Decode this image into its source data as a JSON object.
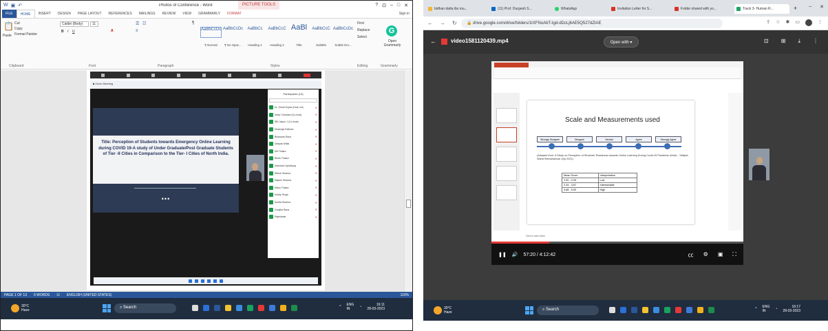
{
  "word": {
    "doc_title": "Photos of Conference - Word",
    "picture_tools": "PICTURE TOOLS",
    "win_controls": [
      "?",
      "⊡",
      "–",
      "□",
      "✕"
    ],
    "tabs": [
      "FILE",
      "HOME",
      "INSERT",
      "DESIGN",
      "PAGE LAYOUT",
      "REFERENCES",
      "MAILINGS",
      "REVIEW",
      "VIEW",
      "GRAMMARLY",
      "FORMAT"
    ],
    "sign_in": "Sign in",
    "clipboard": {
      "cut": "Cut",
      "copy": "Copy",
      "paste": "Paste",
      "format_painter": "Format Painter",
      "label": "Clipboard"
    },
    "font": {
      "name": "Calibri (Body)",
      "size": "11",
      "label": "Font"
    },
    "paragraph_label": "Paragraph",
    "styles": [
      {
        "preview": "AaBbCcDc",
        "name": "¶ Normal"
      },
      {
        "preview": "AaBbCcDc",
        "name": "¶ No Spac..."
      },
      {
        "preview": "AaBbCc",
        "name": "Heading 1"
      },
      {
        "preview": "AaBbCcC",
        "name": "Heading 2"
      },
      {
        "preview": "AaBl",
        "name": "Title"
      },
      {
        "preview": "AaBbCcC",
        "name": "Subtitle"
      },
      {
        "preview": "AaBbCcDc",
        "name": "Subtle Em..."
      }
    ],
    "styles_label": "Styles",
    "editing": {
      "find": "Find",
      "replace": "Replace",
      "select": "Select",
      "label": "Editing"
    },
    "grammarly": {
      "logo": "G",
      "open": "Open Grammarly",
      "label": "Grammarly"
    },
    "meeting": {
      "slide_title": "Title: Perception of Students towards Emergency Online Learning during COVID 19-A study of Under Graduate/Post Graduate Students of Tier -II Cities in Comparison to the Tier- I Cities of North India.",
      "dots": "•••",
      "participants_header": "Participants (19)",
      "participants": [
        "Dr. Shruti Gupta (Host, me)",
        "Deep Chauhan (Co-host)",
        "IBS Jaipur 1 (Co-host)",
        "Dhanraja Rathore",
        "Bhawana Rana",
        "Deepak Mittal",
        "Kiti Thakur",
        "Bindu Thakur",
        "Ashutosh Upadhyay",
        "Ritesh Sharma",
        "Rajeev Sharma",
        "Manu Thakur",
        "Kuldip Singh",
        "Sunita Sharma",
        "Gunjika Rana",
        "Rajeshwar"
      ]
    },
    "status": {
      "page": "PAGE 1 OF 13",
      "words": "0 WORDS",
      "language": "ENGLISH (UNITED STATES)",
      "zoom": "110%"
    }
  },
  "taskbar_left": {
    "temp": "30°C",
    "weather": "Haze",
    "search": "Search",
    "lang": "ENG",
    "region": "IN",
    "time": "16:11",
    "date": "28-03-2023"
  },
  "chrome": {
    "tabs": [
      "bidhan datta ibs mu...",
      "(11) Prof. Durgesh S...",
      "WhatsApp",
      "Invitation Letter for S...",
      "Folder shared with yo...",
      "Track 3- Human R..."
    ],
    "url": "drive.google.com/drive/folders/1tXFNoAbT-Igd-dDcLj6AE5Q527dZIAE",
    "file_name": "video1581120439.mp4",
    "open_with": "Open with",
    "video_time": "57:20 / 4:12:42",
    "progress": 0.23,
    "slide_heading": "Scale and Measurements used",
    "scale_points": [
      "Strongly Disagree",
      "Disagree",
      "Neutral",
      "Agree",
      "Strongly Agree"
    ],
    "caption": "(Adopted from: A Study on Perception of Students' Readiness towards Online Learning During Covid-19 Pandemic Article - Taifiyah Wahid Ramananwar July 2021)",
    "table_header": [
      "Mean Score",
      "Interpretation"
    ],
    "table_rows": [
      [
        "1.00 - 2.33",
        "Low"
      ],
      [
        "2.34 - 3.67",
        "Intermediate"
      ],
      [
        "3.68 - 5.00",
        "High"
      ]
    ],
    "click_notes": "Click to add notes"
  },
  "taskbar_right": {
    "temp": "30°C",
    "weather": "Haze",
    "search": "Search",
    "lang": "ENG",
    "region": "IN",
    "time": "16:17",
    "date": "28-03-2023"
  },
  "colors": {
    "word_blue": "#2b579a",
    "taskbar": "#1f2d3f",
    "grammarly": "#15c39a",
    "red": "#e53935"
  }
}
